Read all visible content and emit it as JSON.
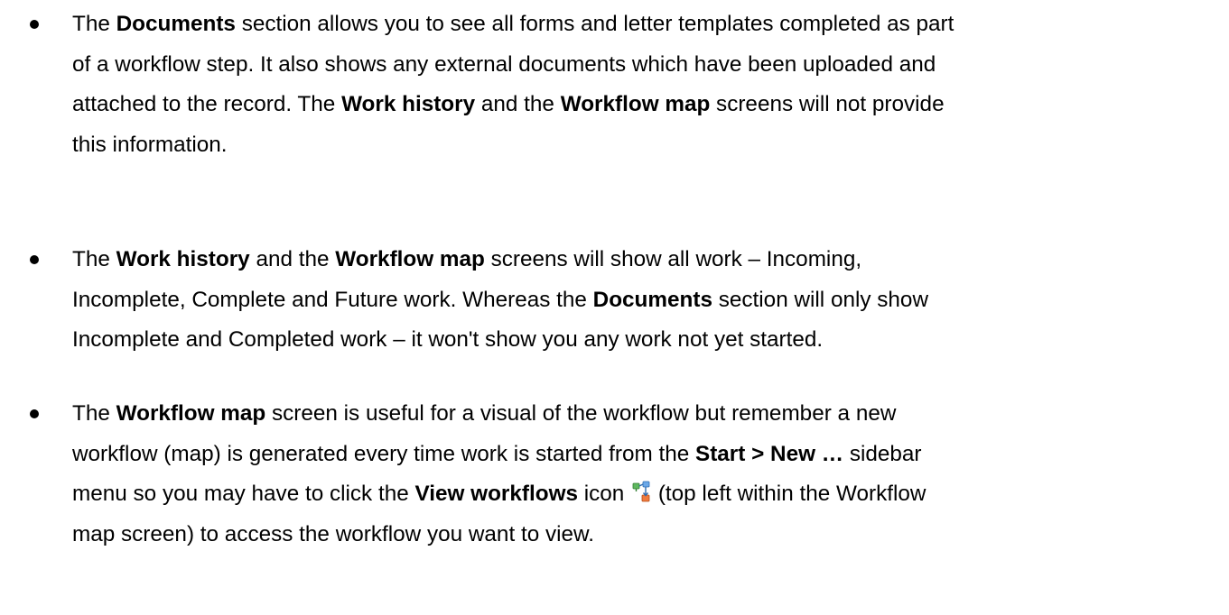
{
  "bullets": [
    {
      "lines": [
        [
          "The ",
          {
            "b": "Documents"
          },
          " section allows you to see all forms and letter templates completed as part"
        ],
        [
          "of a workflow step. It also shows any external documents which have been uploaded and"
        ],
        [
          "attached to the record. The ",
          {
            "b": "Work history"
          },
          " and the ",
          {
            "b": "Workflow map"
          },
          " screens will not provide"
        ],
        [
          "this information."
        ]
      ]
    },
    {
      "lines": [
        [
          "The ",
          {
            "b": "Work history"
          },
          " and the ",
          {
            "b": "Workflow map"
          },
          " screens will show all work – Incoming,"
        ],
        [
          "Incomplete, Complete and Future work. Whereas the ",
          {
            "b": "Documents"
          },
          " section will only show"
        ],
        [
          "Incomplete and Completed work – it won't show you any work not yet started."
        ]
      ]
    },
    {
      "lines": [
        [
          "The ",
          {
            "b": "Workflow map"
          },
          " screen is useful for a visual of the workflow but remember a new"
        ],
        [
          "workflow (map) is generated every time work is started from the ",
          {
            "b": "Start > New …"
          },
          " sidebar"
        ],
        [
          "menu so you may have to click the ",
          {
            "b": "View workflows"
          },
          " icon ",
          {
            "icon": "view-workflows-icon"
          },
          " (top left within the Workflow"
        ],
        [
          "map screen) to access the workflow you want to view."
        ]
      ]
    }
  ]
}
